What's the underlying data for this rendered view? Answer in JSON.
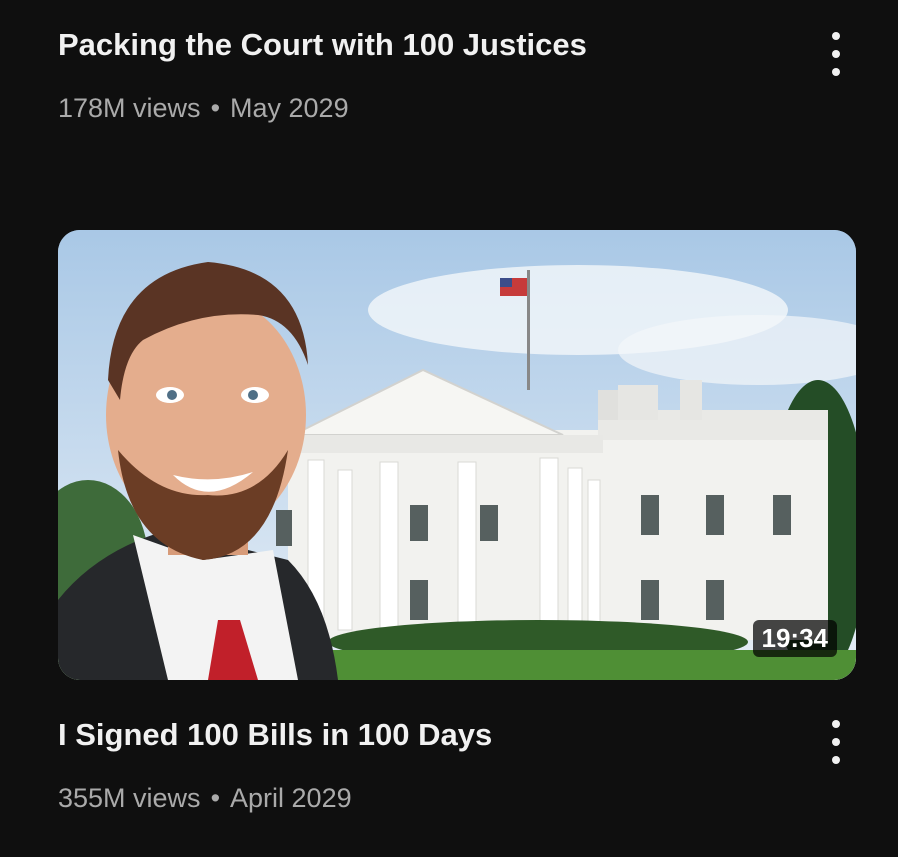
{
  "videos": [
    {
      "title": "Packing the Court with 100 Justices",
      "views": "178M views",
      "separator": "•",
      "date": "May 2029",
      "menu_icon": "more-vert-icon"
    },
    {
      "title": "I Signed 100 Bills in 100 Days",
      "views": "355M views",
      "separator": "•",
      "date": "April 2029",
      "duration": "19:34",
      "thumbnail": "man-in-suit-in-front-of-white-house",
      "menu_icon": "more-vert-icon"
    }
  ],
  "colors": {
    "background": "#0f0f0f",
    "title": "#f1f1f1",
    "subtitle": "#aaaaaa"
  }
}
